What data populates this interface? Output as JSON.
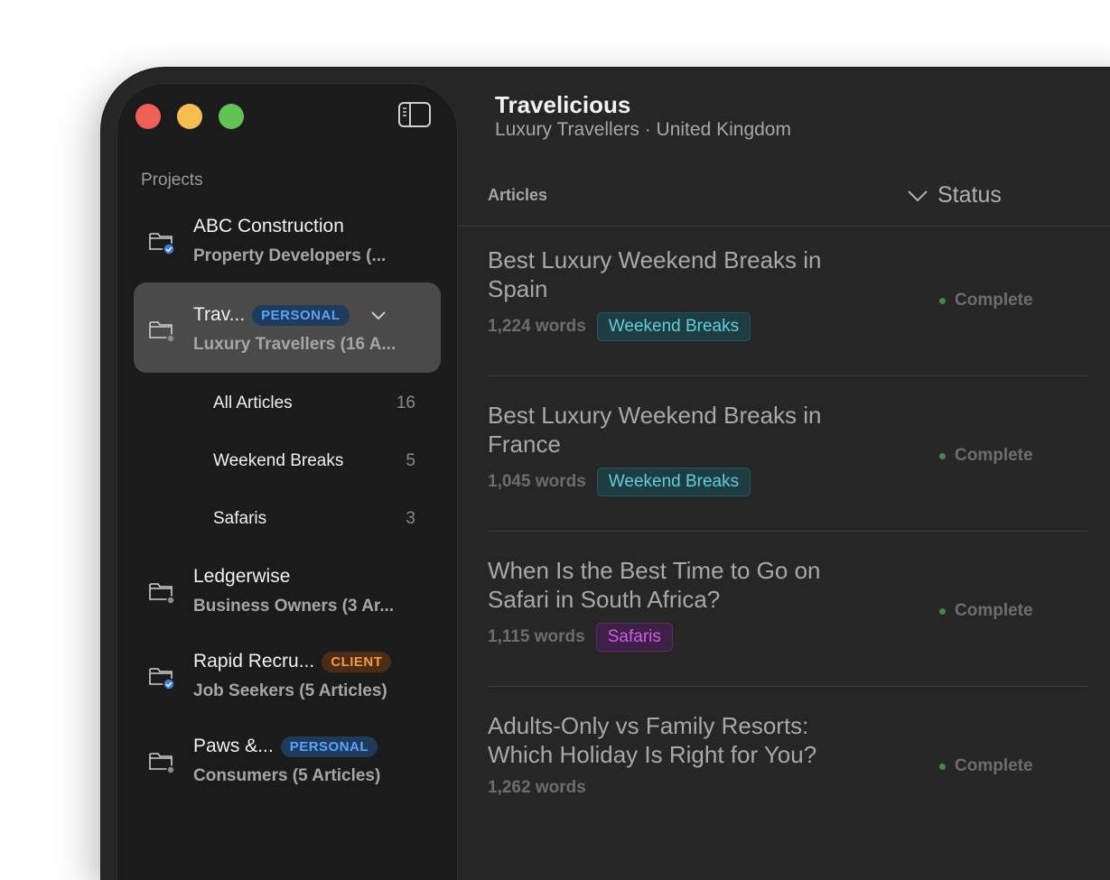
{
  "window": {
    "sidebar_toggle_icon": "sidebar-icon"
  },
  "sidebar": {
    "section_label": "Projects",
    "projects": [
      {
        "name": "ABC Construction",
        "subtitle": "Property Developers (...",
        "icon": "folder-shared-icon",
        "badge": ""
      },
      {
        "name": "Trav...",
        "subtitle": "Luxury Travellers (16 A...",
        "icon": "folder-icon",
        "badge": "PERSONAL",
        "expanded": true
      },
      {
        "name": "Ledgerwise",
        "subtitle": "Business Owners (3 Ar...",
        "icon": "folder-icon",
        "badge": ""
      },
      {
        "name": "Rapid Recru...",
        "subtitle": "Job Seekers (5 Articles)",
        "icon": "folder-shared-icon",
        "badge": "CLIENT"
      },
      {
        "name": "Paws &...",
        "subtitle": "Consumers (5 Articles)",
        "icon": "folder-icon",
        "badge": "PERSONAL"
      }
    ],
    "subitems": [
      {
        "label": "All Articles",
        "count": "16"
      },
      {
        "label": "Weekend Breaks",
        "count": "5"
      },
      {
        "label": "Safaris",
        "count": "3"
      }
    ]
  },
  "main": {
    "title": "Travelicious",
    "subtitle": "Luxury Travellers · United Kingdom",
    "columns": {
      "articles": "Articles",
      "status": "Status"
    },
    "articles": [
      {
        "title": "Best Luxury Weekend Breaks in Spain",
        "words": "1,224 words",
        "tag": "Weekend Breaks",
        "status": "Complete"
      },
      {
        "title": "Best Luxury Weekend Breaks in France",
        "words": "1,045 words",
        "tag": "Weekend Breaks",
        "status": "Complete"
      },
      {
        "title": "When Is the Best Time to Go on Safari in South Africa?",
        "words": "1,115 words",
        "tag": "Safaris",
        "status": "Complete"
      },
      {
        "title": "Adults-Only vs Family Resorts: Which Holiday Is Right for You?",
        "words": "1,262 words",
        "tag": "",
        "status": "Complete"
      }
    ]
  },
  "colors": {
    "personal_badge": "#5aa2ff",
    "client_badge": "#f39a3e",
    "weekend_tag": "#5fcfd8",
    "safari_tag": "#d35be8",
    "status_complete": "#3f8a47"
  }
}
